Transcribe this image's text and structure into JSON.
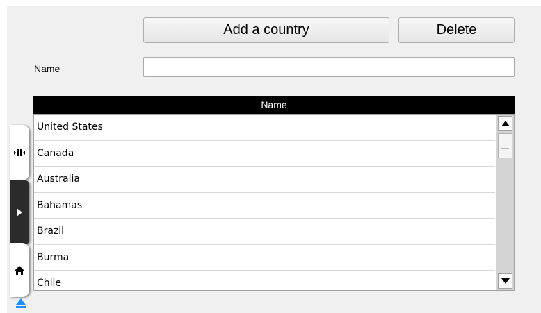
{
  "toolbar": {
    "add_label": "Add a country",
    "delete_label": "Delete"
  },
  "form": {
    "name_label": "Name",
    "name_value": "",
    "name_placeholder": ""
  },
  "grid": {
    "column_header": "Name",
    "rows": [
      "United States",
      "Canada",
      "Australia",
      "Bahamas",
      "Brazil",
      "Burma",
      "Chile"
    ]
  },
  "side_drawer": {
    "tabs": [
      "collapse-arrows-icon",
      "play-icon",
      "home-icon"
    ],
    "eject": "eject-icon"
  },
  "colors": {
    "header_bg": "#000000",
    "panel_bg": "#f0f0f0",
    "active_tab_bg": "#2b2b2b"
  }
}
